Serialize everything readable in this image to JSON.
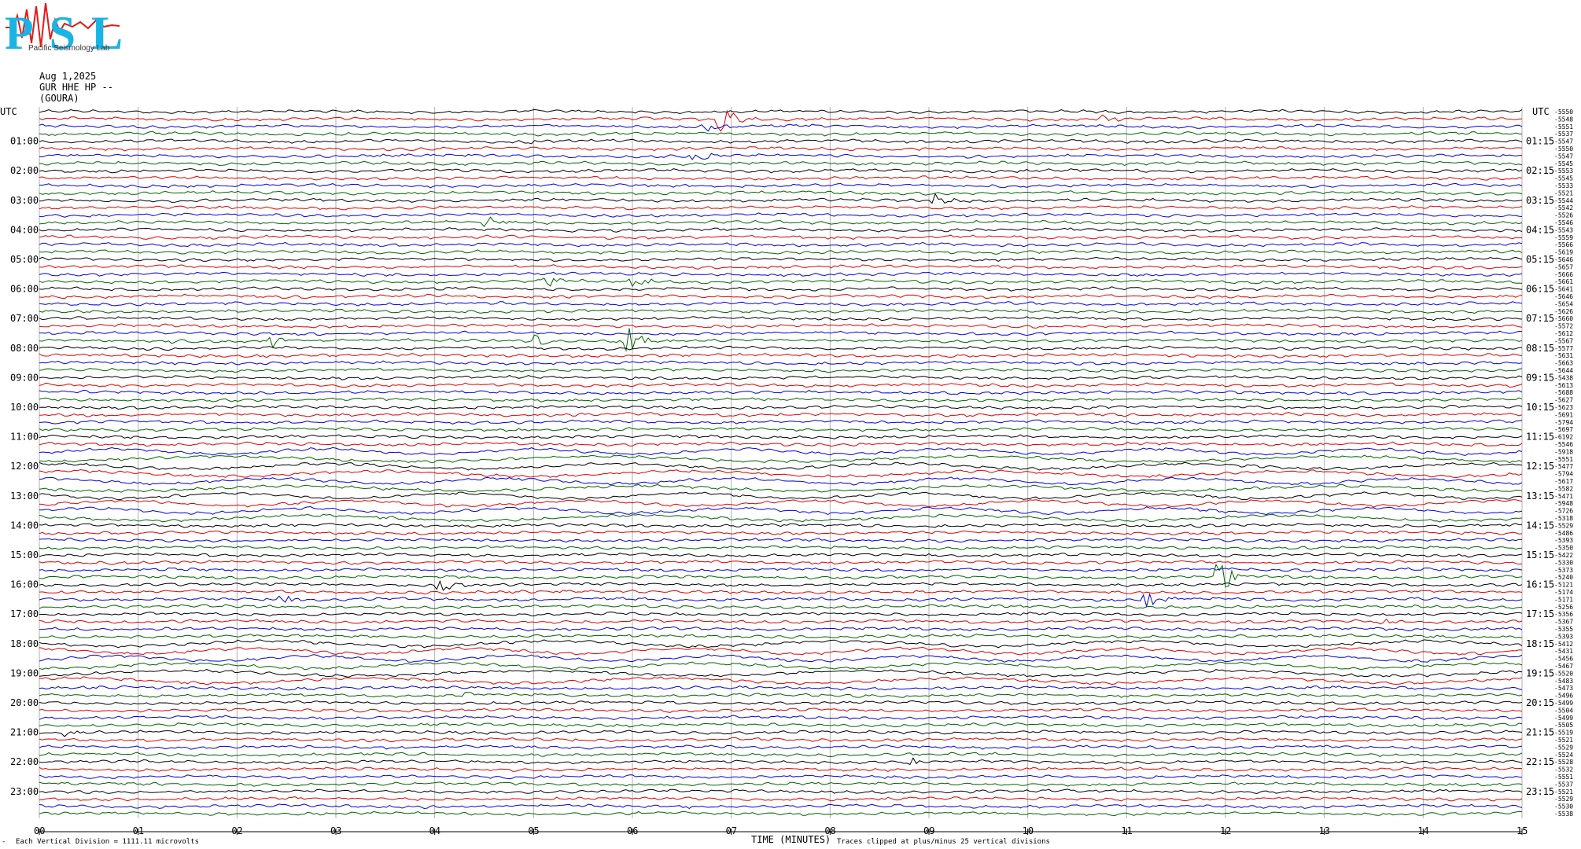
{
  "logo": {
    "letters": "PSL",
    "text": "Pacific Seismology Lab",
    "colors": {
      "letters": "#19b4e6",
      "squiggle": "#e21a1a"
    }
  },
  "header": {
    "date": "Aug 1,2025",
    "station": "GUR HHE HP --",
    "site": "(GOURA)"
  },
  "footer": {
    "division_note": "Each Vertical Division = 1111.11 microvolts",
    "clip_note": "Traces clipped at plus/minus 25 vertical divisions",
    "corner_mark": "-"
  },
  "chart_data": {
    "type": "line",
    "title": "",
    "xlabel": "TIME (MINUTES)",
    "ylabel": "",
    "x_ticks": [
      "00",
      "01",
      "02",
      "03",
      "04",
      "05",
      "06",
      "07",
      "08",
      "09",
      "10",
      "11",
      "12",
      "13",
      "14",
      "15"
    ],
    "xlim": [
      0,
      15
    ],
    "left_axis_header": "UTC",
    "right_axis_header": "UTC",
    "left_hour_labels": [
      "01:00",
      "02:00",
      "03:00",
      "04:00",
      "05:00",
      "06:00",
      "07:00",
      "08:00",
      "09:00",
      "10:00",
      "11:00",
      "12:00",
      "13:00",
      "14:00",
      "15:00",
      "16:00",
      "17:00",
      "18:00",
      "19:00",
      "20:00",
      "21:00",
      "22:00",
      "23:00"
    ],
    "right_hour_labels": [
      "01:15",
      "02:15",
      "03:15",
      "04:15",
      "05:15",
      "06:15",
      "07:15",
      "08:15",
      "09:15",
      "10:15",
      "11:15",
      "12:15",
      "13:15",
      "14:15",
      "15:15",
      "16:15",
      "17:15",
      "18:15",
      "19:15",
      "20:15",
      "21:15",
      "22:15",
      "23:15"
    ],
    "trace_count": 96,
    "minutes_per_trace": 15,
    "trace_colors": [
      "#000000",
      "#e00000",
      "#0000e0",
      "#006400"
    ],
    "trace_offsets": [
      -5550,
      -5548,
      -5551,
      -5537,
      -5547,
      -5550,
      -5547,
      -5545,
      -5553,
      -5545,
      -5533,
      -5521,
      -5544,
      -5542,
      -5526,
      -5546,
      -5543,
      -5559,
      -5566,
      -5619,
      -5646,
      -5657,
      -5666,
      -5661,
      -5641,
      -5646,
      -5654,
      -5626,
      -5660,
      -5572,
      -5612,
      -5567,
      -5577,
      -5631,
      -5663,
      -5644,
      -5438,
      -5613,
      -5688,
      -5627,
      -5623,
      -5691,
      -5794,
      -5697,
      -6192,
      -5546,
      -5918,
      -5551,
      -5477,
      -5794,
      -5617,
      -5582,
      -5471,
      -5948,
      -5726,
      -5318,
      -5529,
      -5486,
      -5393,
      -5350,
      -5422,
      -5330,
      -5373,
      -5240,
      -5121,
      -5174,
      -5171,
      -5256,
      -5356,
      -5367,
      -5355,
      -5393,
      -5412,
      -5431,
      -5456,
      -5467,
      -5520,
      -5483,
      -5473,
      -5496,
      -5499,
      -5504,
      -5499,
      -5505,
      -5519,
      -5521,
      -5529,
      -5524,
      -5528,
      -5532,
      -5551,
      -5537,
      -5521,
      -5529,
      -5530,
      -5538
    ],
    "events": [
      {
        "trace": 1,
        "minute": 6.9,
        "amplitude": 18
      },
      {
        "trace": 2,
        "minute": 6.75,
        "amplitude": 6
      },
      {
        "trace": 1,
        "minute": 10.75,
        "amplitude": 5
      },
      {
        "trace": 4,
        "minute": 4.85,
        "amplitude": 4
      },
      {
        "trace": 6,
        "minute": 6.65,
        "amplitude": 8
      },
      {
        "trace": 12,
        "minute": 9.05,
        "amplitude": 9
      },
      {
        "trace": 15,
        "minute": 4.55,
        "amplitude": 6
      },
      {
        "trace": 23,
        "minute": 5.1,
        "amplitude": 9
      },
      {
        "trace": 23,
        "minute": 6.0,
        "amplitude": 8
      },
      {
        "trace": 31,
        "minute": 1.3,
        "amplitude": 5
      },
      {
        "trace": 31,
        "minute": 2.3,
        "amplitude": 14
      },
      {
        "trace": 31,
        "minute": 5.0,
        "amplitude": 8
      },
      {
        "trace": 31,
        "minute": 5.95,
        "amplitude": 18
      },
      {
        "trace": 63,
        "minute": 11.95,
        "amplitude": 22
      },
      {
        "trace": 64,
        "minute": 4.05,
        "amplitude": 10
      },
      {
        "trace": 66,
        "minute": 11.2,
        "amplitude": 14
      },
      {
        "trace": 66,
        "minute": 2.45,
        "amplitude": 7
      },
      {
        "trace": 69,
        "minute": 13.55,
        "amplitude": 6
      },
      {
        "trace": 79,
        "minute": 4.3,
        "amplitude": 4
      },
      {
        "trace": 84,
        "minute": 0.25,
        "amplitude": 4
      },
      {
        "trace": 88,
        "minute": 8.85,
        "amplitude": 4
      }
    ]
  }
}
